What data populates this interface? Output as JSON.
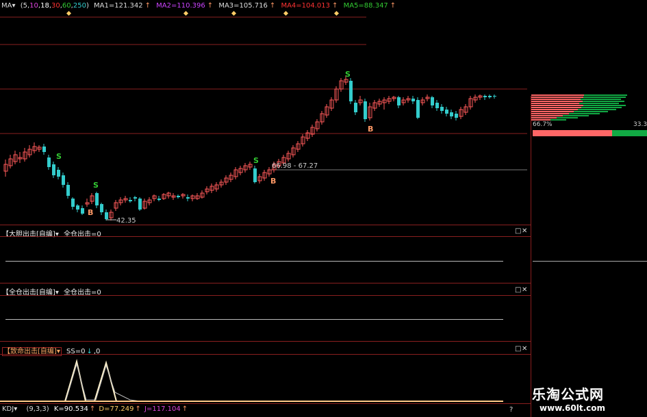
{
  "ma_bar": {
    "name": "MA",
    "params": [
      "5",
      "10",
      "18",
      "30",
      "60",
      "250"
    ],
    "param_colors": [
      "#dddddd",
      "#dd44dd",
      "#ffffff",
      "#ff3333",
      "#33cc33",
      "#33cccc"
    ],
    "items": [
      {
        "label": "MA1=121.342",
        "color": "#dddddd"
      },
      {
        "label": "MA2=110.396",
        "color": "#cc44ff"
      },
      {
        "label": "MA3=105.716",
        "color": "#dddddd"
      },
      {
        "label": "MA4=104.013",
        "color": "#ff3333"
      },
      {
        "label": "MA5=88.347",
        "color": "#33cc33"
      }
    ],
    "arrow": "↑"
  },
  "main_chart": {
    "signals": [
      {
        "text": "S",
        "color": "#33cc33"
      },
      {
        "text": "S",
        "color": "#33cc33"
      },
      {
        "text": "S",
        "color": "#33cc33"
      },
      {
        "text": "S",
        "color": "#33cc33"
      },
      {
        "text": "B",
        "color": "#ff9966"
      },
      {
        "text": "B",
        "color": "#ff9966"
      },
      {
        "text": "B",
        "color": "#ff9966"
      }
    ],
    "low_label": "42.35",
    "range_label": "66.98 - 67.27",
    "colors": {
      "up": "#ff5a5a",
      "down": "#33cccc",
      "grid": "#8a1f1f"
    }
  },
  "side_panel": {
    "pct_left": "66.7%",
    "pct_right": "33.3",
    "bar_colors": [
      "#ff6666",
      "#11aa44"
    ]
  },
  "panels": [
    {
      "title": "【大胆出击[自编]",
      "arrow": "▾",
      "formula": "全仓出击=0"
    },
    {
      "title": "【全仓出击[自编]",
      "arrow": "▾",
      "formula": "全仓出击=0"
    },
    {
      "title": "【致命出击[自编]",
      "arrow": "▾",
      "formula": "SS=0",
      "formula2": ",0"
    }
  ],
  "panel_controls": {
    "max": "□",
    "close": "✕"
  },
  "kdj_bar": {
    "name": "KDJ",
    "params": "(9,3,3)",
    "k": "K=90.534",
    "d": "D=77.249",
    "j": "J=117.104",
    "arrow": "↑",
    "help": "?"
  },
  "watermark": {
    "line1": "乐淘公式网",
    "line2": "www.60lt.com"
  }
}
